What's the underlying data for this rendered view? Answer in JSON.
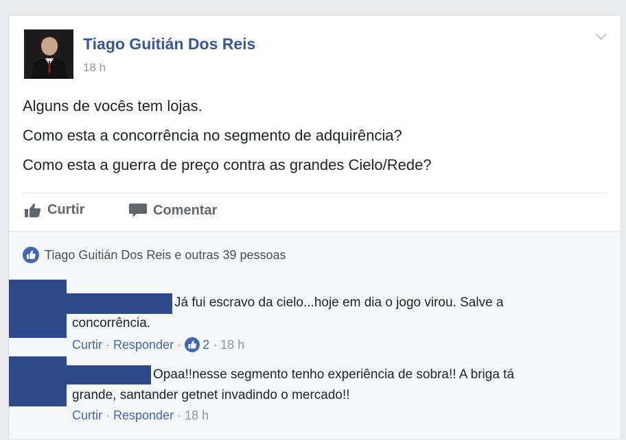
{
  "post": {
    "author": "Tiago Guitián Dos Reis",
    "time": "18 h",
    "body": [
      "Alguns de vocês tem lojas.",
      "Como esta a concorrência no segmento de adquirência?",
      "Como esta a guerra de preço contra as grandes Cielo/Rede?"
    ]
  },
  "actions": {
    "like_label": "Curtir",
    "comment_label": "Comentar"
  },
  "reactions": {
    "summary": "Tiago Guitián Dos Reis e outras 39 pessoas"
  },
  "comments": [
    {
      "text_line1": "Já fui escravo da cielo...hoje em dia o jogo virou. Salve a",
      "text_line2": "concorrência.",
      "like": "Curtir",
      "reply": "Responder",
      "like_count": "2",
      "time": "18 h"
    },
    {
      "text_line1": "Opaa!!nesse segmento tenho experiência de sobra!! A briga tá",
      "text_line2": "grande, santander getnet invadindo o mercado!!",
      "like": "Curtir",
      "reply": "Responder",
      "time": "18 h"
    }
  ],
  "colors": {
    "link_blue": "#365899",
    "like_blue": "#4267b2",
    "redaction": "#2c4a8a",
    "meta_grey": "#90949c"
  },
  "icons": {
    "more": "chevron-down-icon",
    "like": "thumbs-up-icon",
    "comment": "speech-bubble-icon",
    "reaction": "like-reaction-icon"
  }
}
